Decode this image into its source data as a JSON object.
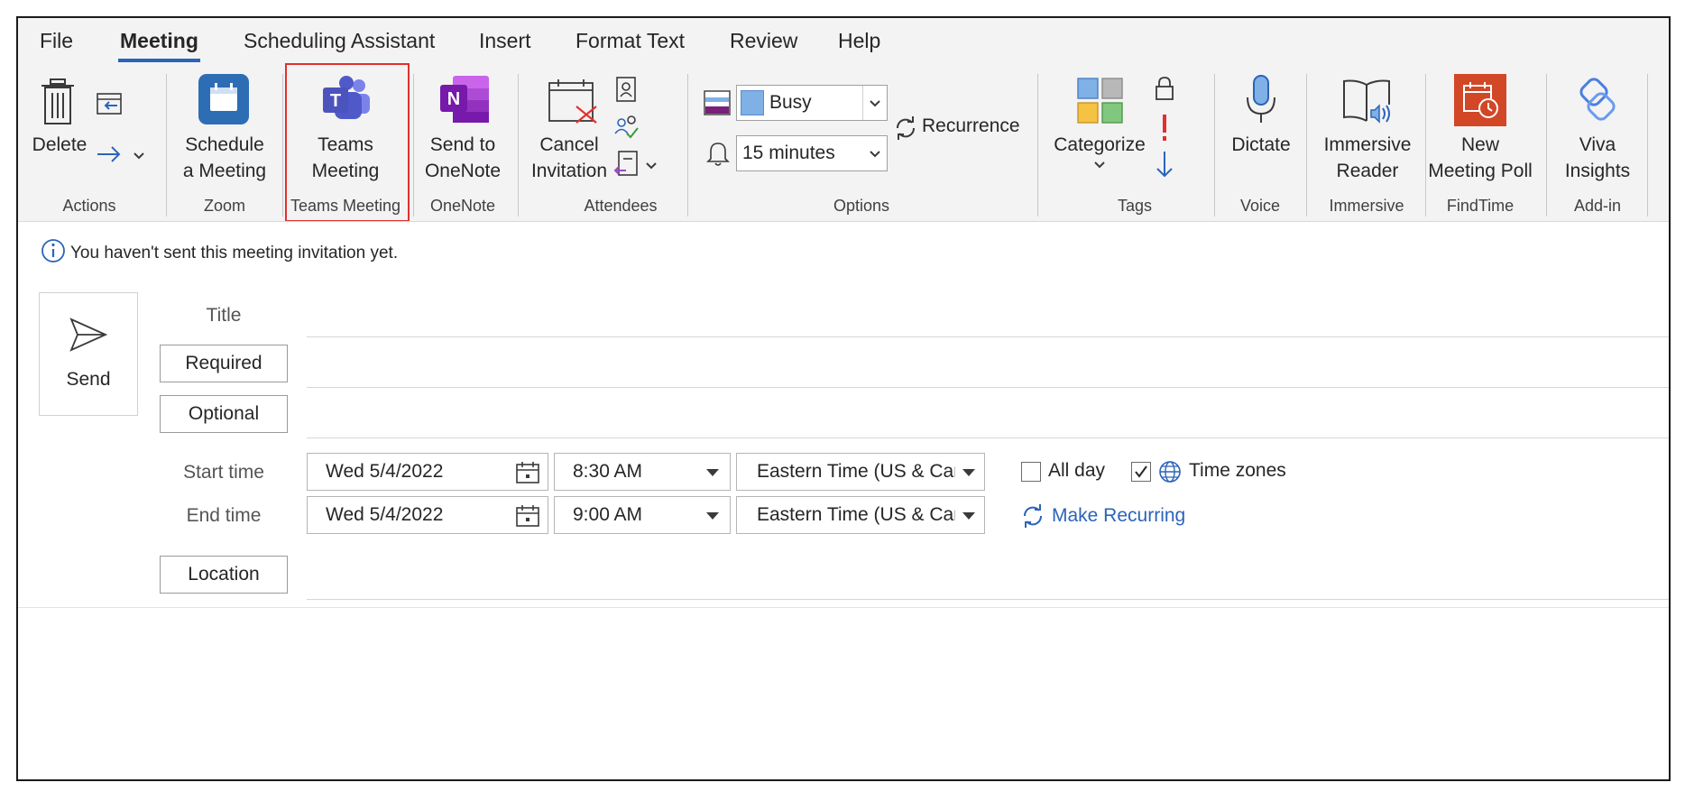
{
  "tabs": [
    "File",
    "Meeting",
    "Scheduling Assistant",
    "Insert",
    "Format Text",
    "Review",
    "Help"
  ],
  "active_tab": "Meeting",
  "ribbon": {
    "actions": {
      "delete_label": "Delete",
      "group_label": "Actions"
    },
    "zoom": {
      "button_line1": "Schedule",
      "button_line2": "a Meeting",
      "group_label": "Zoom"
    },
    "teams": {
      "button_line1": "Teams",
      "button_line2": "Meeting",
      "group_label": "Teams Meeting"
    },
    "onenote": {
      "button_line1": "Send to",
      "button_line2": "OneNote",
      "group_label": "OneNote"
    },
    "attendees": {
      "button_line1": "Cancel",
      "button_line2": "Invitation",
      "group_label": "Attendees"
    },
    "options": {
      "show_as": "Busy",
      "reminder": "15 minutes",
      "recurrence_label": "Recurrence",
      "group_label": "Options"
    },
    "tags": {
      "categorize_label": "Categorize",
      "group_label": "Tags"
    },
    "voice": {
      "dictate_label": "Dictate",
      "group_label": "Voice"
    },
    "immersive": {
      "button_line1": "Immersive",
      "button_line2": "Reader",
      "group_label": "Immersive"
    },
    "findtime": {
      "button_line1": "New",
      "button_line2": "Meeting Poll",
      "group_label": "FindTime"
    },
    "addin": {
      "button_line1": "Viva",
      "button_line2": "Insights",
      "group_label": "Add-in"
    }
  },
  "info_bar": {
    "message": "You haven't sent this meeting invitation yet."
  },
  "form": {
    "send_label": "Send",
    "title_label": "Title",
    "required_label": "Required",
    "optional_label": "Optional",
    "start_label": "Start time",
    "end_label": "End time",
    "start_date": "Wed 5/4/2022",
    "start_time": "8:30 AM",
    "end_date": "Wed 5/4/2022",
    "end_time": "9:00 AM",
    "timezone": "Eastern Time (US & Canada)",
    "all_day_label": "All day",
    "all_day_checked": false,
    "time_zones_label": "Time zones",
    "time_zones_checked": true,
    "make_recurring_label": "Make Recurring",
    "location_label": "Location"
  },
  "colors": {
    "accent": "#2b64b9",
    "highlight": "#e0312f",
    "ribbon_bg": "#f3f3f3",
    "teams": "#5059c9",
    "onenote": "#7719aa",
    "zoom": "#2d6db3",
    "findtime": "#d24726"
  }
}
